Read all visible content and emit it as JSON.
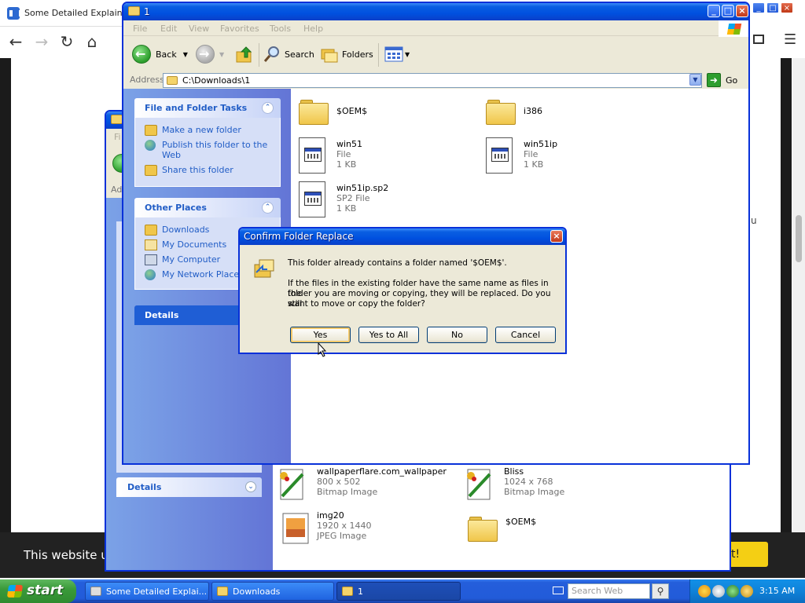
{
  "browser": {
    "tab_title": "Some Detailed Explainat",
    "side_text": "u",
    "cookie_text": "This website us",
    "cookie_button": "t!"
  },
  "back_window": {
    "title_fragments": [
      "Fi",
      "Ad"
    ],
    "details_label": "Details",
    "files": [
      {
        "name": "wallpaperflare.com_wallpaper",
        "line2": "800 x 502",
        "line3": "Bitmap Image",
        "icon": "paint-bitmap-icon"
      },
      {
        "name": "Bliss",
        "line2": "1024 x 768",
        "line3": "Bitmap Image",
        "icon": "paint-bitmap-icon"
      },
      {
        "name": "img20",
        "line2": "1920 x 1440",
        "line3": "JPEG Image",
        "icon": "jpeg-image-icon"
      },
      {
        "name": "$OEM$",
        "line2": "",
        "line3": "",
        "icon": "folder-icon"
      }
    ]
  },
  "front_window": {
    "title": "1",
    "menu": [
      "File",
      "Edit",
      "View",
      "Favorites",
      "Tools",
      "Help"
    ],
    "toolbar": {
      "back": "Back",
      "search": "Search",
      "folders": "Folders"
    },
    "address_label": "Address",
    "address_value": "C:\\Downloads\\1",
    "go_label": "Go",
    "file_tasks": {
      "header": "File and Folder Tasks",
      "items": [
        "Make a new folder",
        "Publish this folder to the Web",
        "Share this folder"
      ]
    },
    "other_places": {
      "header": "Other Places",
      "items": [
        "Downloads",
        "My Documents",
        "My Computer",
        "My Network Places"
      ]
    },
    "details_header": "Details",
    "files": [
      {
        "name": "$OEM$",
        "line2": "",
        "line3": "",
        "type": "folder"
      },
      {
        "name": "i386",
        "line2": "",
        "line3": "",
        "type": "folder"
      },
      {
        "name": "win51",
        "line2": "File",
        "line3": "1 KB",
        "type": "doc"
      },
      {
        "name": "win51ip",
        "line2": "File",
        "line3": "1 KB",
        "type": "doc"
      },
      {
        "name": "win51ip.sp2",
        "line2": "SP2 File",
        "line3": "1 KB",
        "type": "doc"
      }
    ]
  },
  "dialog": {
    "title": "Confirm Folder Replace",
    "line1": "This folder already contains a folder named '$OEM$'.",
    "para": [
      "If the files in the existing folder have the same name as files in the",
      "folder you are moving or copying, they will be replaced.  Do you still",
      "want to move or copy the folder?"
    ],
    "buttons": {
      "yes": "Yes",
      "yes_all": "Yes to All",
      "no": "No",
      "cancel": "Cancel"
    }
  },
  "taskbar": {
    "start": "start",
    "tasks": [
      "Some Detailed Explai...",
      "Downloads",
      "1"
    ],
    "search_placeholder": "Search Web",
    "clock": "3:15 AM"
  },
  "colors": {
    "xp_blue": "#0831d9",
    "task_link": "#215dc6",
    "taskbar": "#245edb",
    "start_green": "#3a9a3a"
  }
}
